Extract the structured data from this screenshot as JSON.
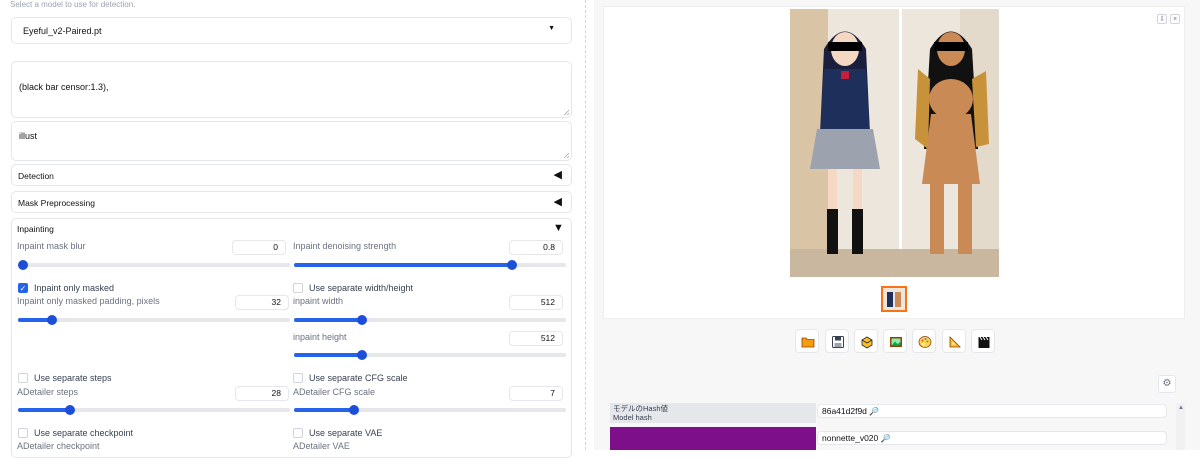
{
  "detection_hint": "Select a model to use for detection.",
  "model": {
    "selected": "Eyeful_v2-Paired.pt"
  },
  "prompt": {
    "value": "(black bar censor:1.3),"
  },
  "negative_prompt": {
    "value": "illust"
  },
  "sections": {
    "detection": "Detection",
    "mask_preprocessing": "Mask Preprocessing",
    "inpainting": "Inpainting"
  },
  "inpaint": {
    "mask_blur": {
      "label": "Inpaint mask blur",
      "value": "0",
      "fraction": 0.0
    },
    "denoising": {
      "label": "Inpaint denoising strength",
      "value": "0.8",
      "fraction": 0.8
    },
    "only_masked": {
      "label": "Inpaint only masked",
      "checked": true
    },
    "separate_wh": {
      "label": "Use separate width/height",
      "checked": false
    },
    "padding": {
      "label": "Inpaint only masked padding, pixels",
      "value": "32",
      "fraction": 0.125
    },
    "width": {
      "label": "inpaint width",
      "value": "512",
      "fraction": 0.25
    },
    "height": {
      "label": "inpaint height",
      "value": "512",
      "fraction": 0.25
    },
    "separate_steps": {
      "label": "Use separate steps",
      "checked": false
    },
    "separate_cfg": {
      "label": "Use separate CFG scale",
      "checked": false
    },
    "steps": {
      "label": "ADetailer steps",
      "value": "28",
      "fraction": 0.19
    },
    "cfg": {
      "label": "ADetailer CFG scale",
      "value": "7",
      "fraction": 0.22
    },
    "separate_checkpoint": {
      "label": "Use separate checkpoint",
      "checked": false
    },
    "separate_vae": {
      "label": "Use separate VAE",
      "checked": false
    },
    "checkpoint_label": "ADetailer checkpoint",
    "vae_label": "ADetailer VAE"
  },
  "gallery": {
    "download_icon": "⇩",
    "close_icon": "×"
  },
  "info": {
    "rows": [
      {
        "label_jp": "モデルのHash値",
        "label_en": "Model hash",
        "value": "86a41d2f9d"
      },
      {
        "label_jp": "",
        "label_en": "",
        "value": "nonnette_v020"
      }
    ]
  },
  "colors": {
    "accent": "#2563eb",
    "thumb_border": "#f97316",
    "purple_row": "#7e0f8a"
  }
}
